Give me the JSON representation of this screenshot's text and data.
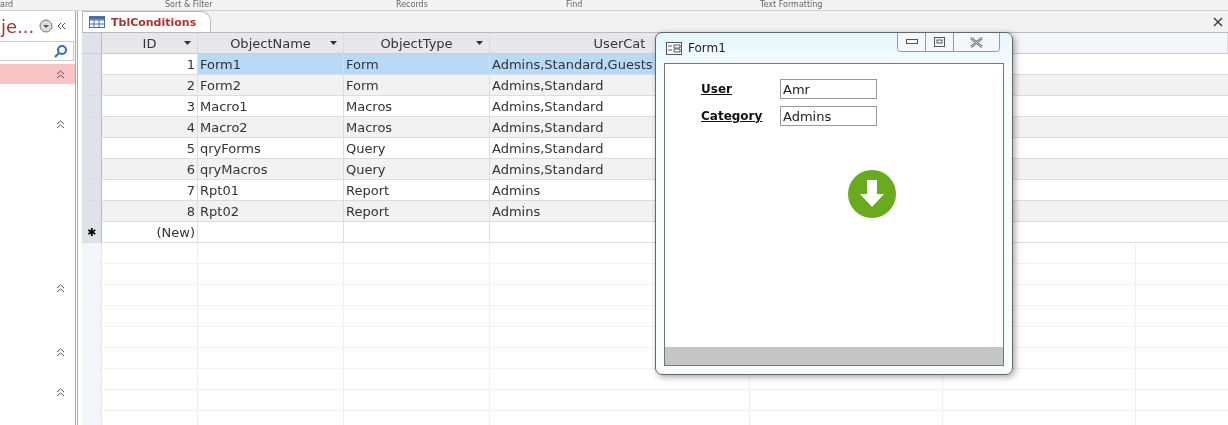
{
  "ribbon_groups": [
    {
      "label": "ard"
    },
    {
      "label": "Sort & Filter"
    },
    {
      "label": "Records"
    },
    {
      "label": "Find"
    },
    {
      "label": "Text Formatting"
    }
  ],
  "nav_pane": {
    "title": "je...",
    "search": {
      "kind": "field"
    },
    "groups": [
      {
        "expanded": true,
        "highlighted": true
      },
      {
        "expanded": true,
        "highlighted": false
      },
      {
        "expanded": true,
        "highlighted": false
      },
      {
        "expanded": true,
        "highlighted": false
      },
      {
        "expanded": true,
        "highlighted": false
      }
    ]
  },
  "tabs": [
    {
      "label": "TblConditions",
      "selected": true
    }
  ],
  "table": {
    "columns": [
      "ID",
      "ObjectName",
      "ObjectType",
      "UserCat"
    ],
    "rows": [
      {
        "cells": [
          "1",
          "Form1",
          "Form",
          "Admins,Standard,Guests"
        ],
        "selected": true
      },
      {
        "cells": [
          "2",
          "Form2",
          "Form",
          "Admins,Standard"
        ],
        "selected": false
      },
      {
        "cells": [
          "3",
          "Macro1",
          "Macros",
          "Admins,Standard"
        ],
        "selected": false
      },
      {
        "cells": [
          "4",
          "Macro2",
          "Macros",
          "Admins,Standard"
        ],
        "selected": false
      },
      {
        "cells": [
          "5",
          "qryForms",
          "Query",
          "Admins,Standard"
        ],
        "selected": false
      },
      {
        "cells": [
          "6",
          "qryMacros",
          "Query",
          "Admins,Standard"
        ],
        "selected": false
      },
      {
        "cells": [
          "7",
          "Rpt01",
          "Report",
          "Admins"
        ],
        "selected": false
      },
      {
        "cells": [
          "8",
          "Rpt02",
          "Report",
          "Admins"
        ],
        "selected": false
      }
    ],
    "new_row": {
      "marker": "✱",
      "label": "(New)"
    }
  },
  "form_window": {
    "title": "Form1",
    "fields": [
      {
        "label": "User",
        "value": "Amr"
      },
      {
        "label": "Category",
        "value": "Admins"
      }
    ]
  }
}
